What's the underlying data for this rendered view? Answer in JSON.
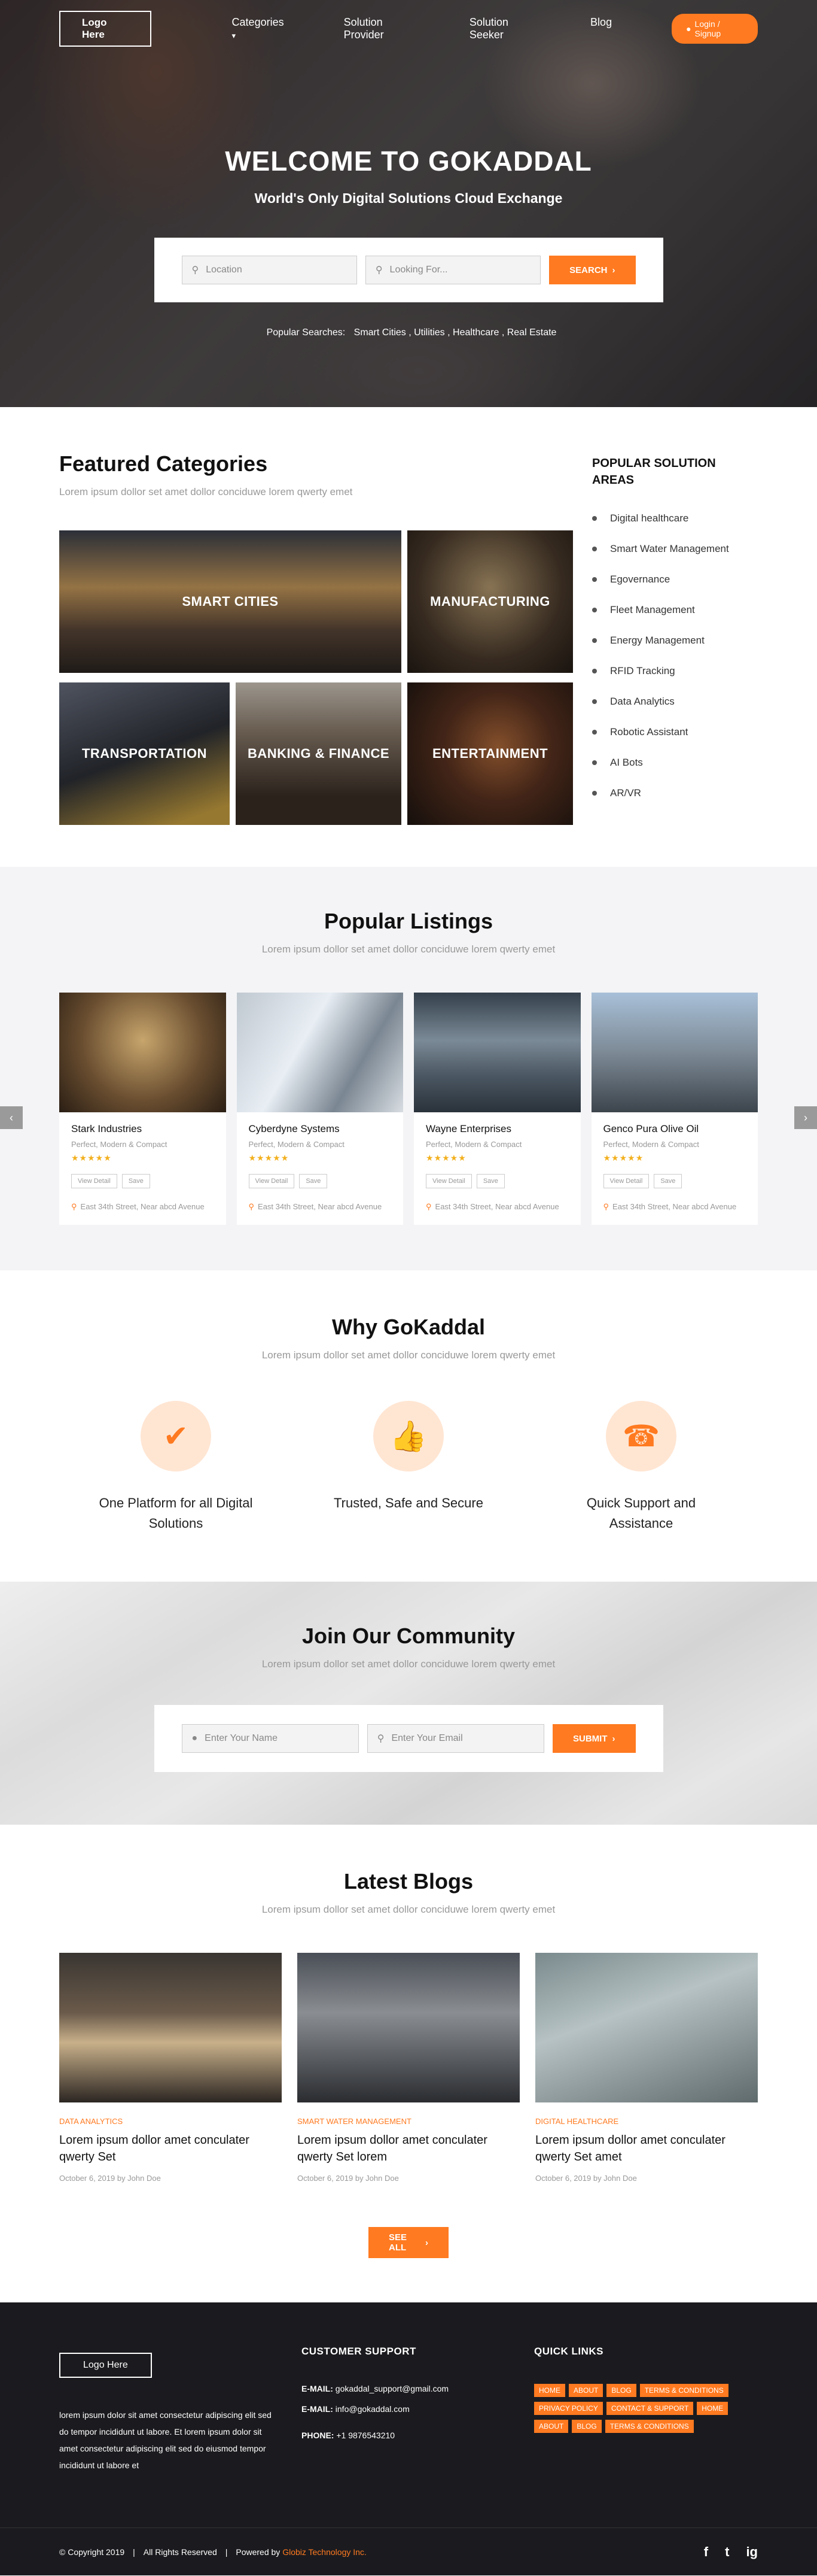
{
  "nav": {
    "logo": "Logo Here",
    "links": [
      "Categories",
      "Solution Provider",
      "Solution Seeker",
      "Blog"
    ],
    "login": "Login / Signup"
  },
  "hero": {
    "title": "WELCOME TO GOKADDAL",
    "subtitle": "World's Only Digital Solutions Cloud Exchange",
    "location_placeholder": "Location",
    "looking_placeholder": "Looking For...",
    "search_button": "SEARCH",
    "popular_label": "Popular Searches:",
    "popular_items": "Smart Cities , Utilities , Healthcare , Real Estate"
  },
  "featured": {
    "title": "Featured Categories",
    "subtitle": "Lorem ipsum dollor set amet dollor conciduwe lorem qwerty emet",
    "tiles": [
      "SMART CITIES",
      "MANUFACTURING",
      "TRANSPORTATION",
      "BANKING & FINANCE",
      "ENTERTAINMENT"
    ]
  },
  "popular_areas": {
    "title": "POPULAR SOLUTION AREAS",
    "items": [
      "Digital healthcare",
      "Smart Water Management",
      "Egovernance",
      "Fleet Management",
      "Energy Management",
      "RFID Tracking",
      "Data Analytics",
      "Robotic Assistant",
      "AI Bots",
      "AR/VR"
    ]
  },
  "listings": {
    "title": "Popular Listings",
    "subtitle": "Lorem ipsum dollor set amet dollor conciduwe lorem qwerty emet",
    "cards": [
      {
        "name": "Stark Industries",
        "tag": "Perfect, Modern & Compact",
        "address": "East 34th Street, Near abcd Avenue"
      },
      {
        "name": "Cyberdyne Systems",
        "tag": "Perfect, Modern & Compact",
        "address": "East 34th Street, Near abcd Avenue"
      },
      {
        "name": "Wayne Enterprises",
        "tag": "Perfect, Modern & Compact",
        "address": "East 34th Street, Near abcd Avenue"
      },
      {
        "name": "Genco Pura Olive Oil",
        "tag": "Perfect, Modern & Compact",
        "address": "East 34th Street, Near abcd Avenue"
      }
    ],
    "view_detail": "View Detail",
    "save": "Save",
    "stars": "★★★★★"
  },
  "why": {
    "title": "Why GoKaddal",
    "subtitle": "Lorem ipsum dollor set amet dollor conciduwe lorem qwerty emet",
    "items": [
      "One Platform for all Digital Solutions",
      "Trusted, Safe and Secure",
      "Quick Support and Assistance"
    ]
  },
  "community": {
    "title": "Join Our Community",
    "subtitle": "Lorem ipsum dollor set amet dollor conciduwe lorem qwerty emet",
    "name_placeholder": "Enter Your Name",
    "email_placeholder": "Enter Your Email",
    "submit": "SUBMIT"
  },
  "blogs": {
    "title": "Latest Blogs",
    "subtitle": "Lorem ipsum dollor set amet dollor conciduwe lorem qwerty emet",
    "posts": [
      {
        "category": "DATA ANALYTICS",
        "title": "Lorem ipsum dollor amet conculater qwerty Set",
        "date": "October 6, 2019 by John Doe"
      },
      {
        "category": "SMART WATER MANAGEMENT",
        "title": "Lorem ipsum dollor amet conculater qwerty Set lorem",
        "date": "October 6, 2019 by John Doe"
      },
      {
        "category": "DIGITAL HEALTHCARE",
        "title": "Lorem ipsum dollor amet conculater qwerty Set amet",
        "date": "October 6, 2019 by John Doe"
      }
    ],
    "see_all": "SEE ALL"
  },
  "footer": {
    "logo": "Logo Here",
    "about": "lorem ipsum dolor sit amet consectetur adipiscing elit sed do tempor incididunt ut labore. Et lorem ipsum dolor sit amet consectetur adipiscing elit sed do eiusmod tempor incididunt ut labore et",
    "support_title": "CUSTOMER SUPPORT",
    "email1_label": "E-MAIL:",
    "email1": "gokaddal_support@gmail.com",
    "email2_label": "E-MAIL:",
    "email2": "info@gokaddal.com",
    "phone_label": "PHONE:",
    "phone": "+1 9876543210",
    "quick_title": "QUICK LINKS",
    "quick_links": [
      "HOME",
      "ABOUT",
      "BLOG",
      "TERMS & CONDITIONS",
      "PRIVACY POLICY",
      "CONTACT & SUPPORT",
      "HOME",
      "ABOUT",
      "BLOG",
      "TERMS & CONDITIONS"
    ],
    "copyright": "© Copyright 2019",
    "rights": "All Rights Reserved",
    "powered_label": "Powered by",
    "powered_by": "Globiz Technology Inc.",
    "social": [
      "f",
      "t",
      "ig"
    ]
  },
  "colors": {
    "accent": "#ff7a20",
    "footer_bg": "#1b1b1f"
  }
}
